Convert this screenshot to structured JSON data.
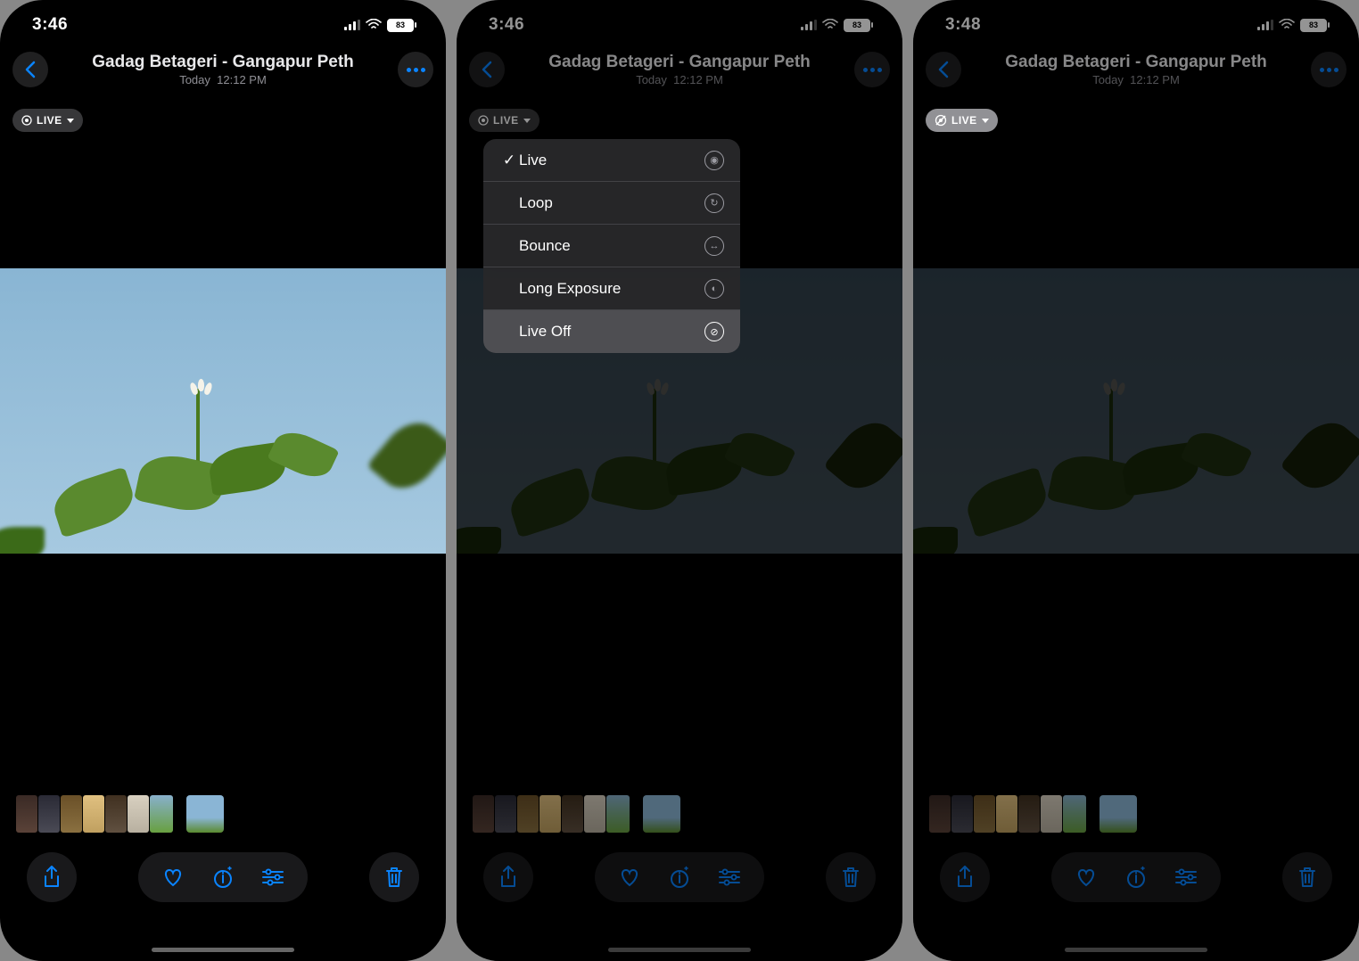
{
  "screens": [
    {
      "status": {
        "time": "3:46",
        "battery": "83"
      },
      "header": {
        "title": "Gadag Betageri - Gangapur Peth",
        "subtitle_day": "Today",
        "subtitle_time": "12:12 PM"
      },
      "live_badge": {
        "label": "LIVE",
        "state": "on"
      },
      "menu_open": false,
      "dimmed": false
    },
    {
      "status": {
        "time": "3:46",
        "battery": "83"
      },
      "header": {
        "title": "Gadag Betageri - Gangapur Peth",
        "subtitle_day": "Today",
        "subtitle_time": "12:12 PM"
      },
      "live_badge": {
        "label": "LIVE",
        "state": "on"
      },
      "menu_open": true,
      "dimmed": true,
      "menu": [
        {
          "label": "Live",
          "checked": true,
          "icon": "live-icon",
          "highlight": false
        },
        {
          "label": "Loop",
          "checked": false,
          "icon": "loop-icon",
          "highlight": false
        },
        {
          "label": "Bounce",
          "checked": false,
          "icon": "bounce-icon",
          "highlight": false
        },
        {
          "label": "Long Exposure",
          "checked": false,
          "icon": "long-exposure-icon",
          "highlight": false
        },
        {
          "label": "Live Off",
          "checked": false,
          "icon": "live-off-icon",
          "highlight": true
        }
      ]
    },
    {
      "status": {
        "time": "3:48",
        "battery": "83"
      },
      "header": {
        "title": "Gadag Betageri - Gangapur Peth",
        "subtitle_day": "Today",
        "subtitle_time": "12:12 PM"
      },
      "live_badge": {
        "label": "LIVE",
        "state": "off"
      },
      "menu_open": false,
      "dimmed": true
    }
  ],
  "icons": {
    "back": "chevron-left-icon",
    "more": "ellipsis-icon",
    "share": "share-icon",
    "favorite": "heart-icon",
    "info": "info-icon",
    "adjust": "sliders-icon",
    "trash": "trash-icon",
    "wifi": "wifi-icon",
    "cellular": "cellular-icon"
  },
  "colors": {
    "accent": "#0a84ff"
  }
}
